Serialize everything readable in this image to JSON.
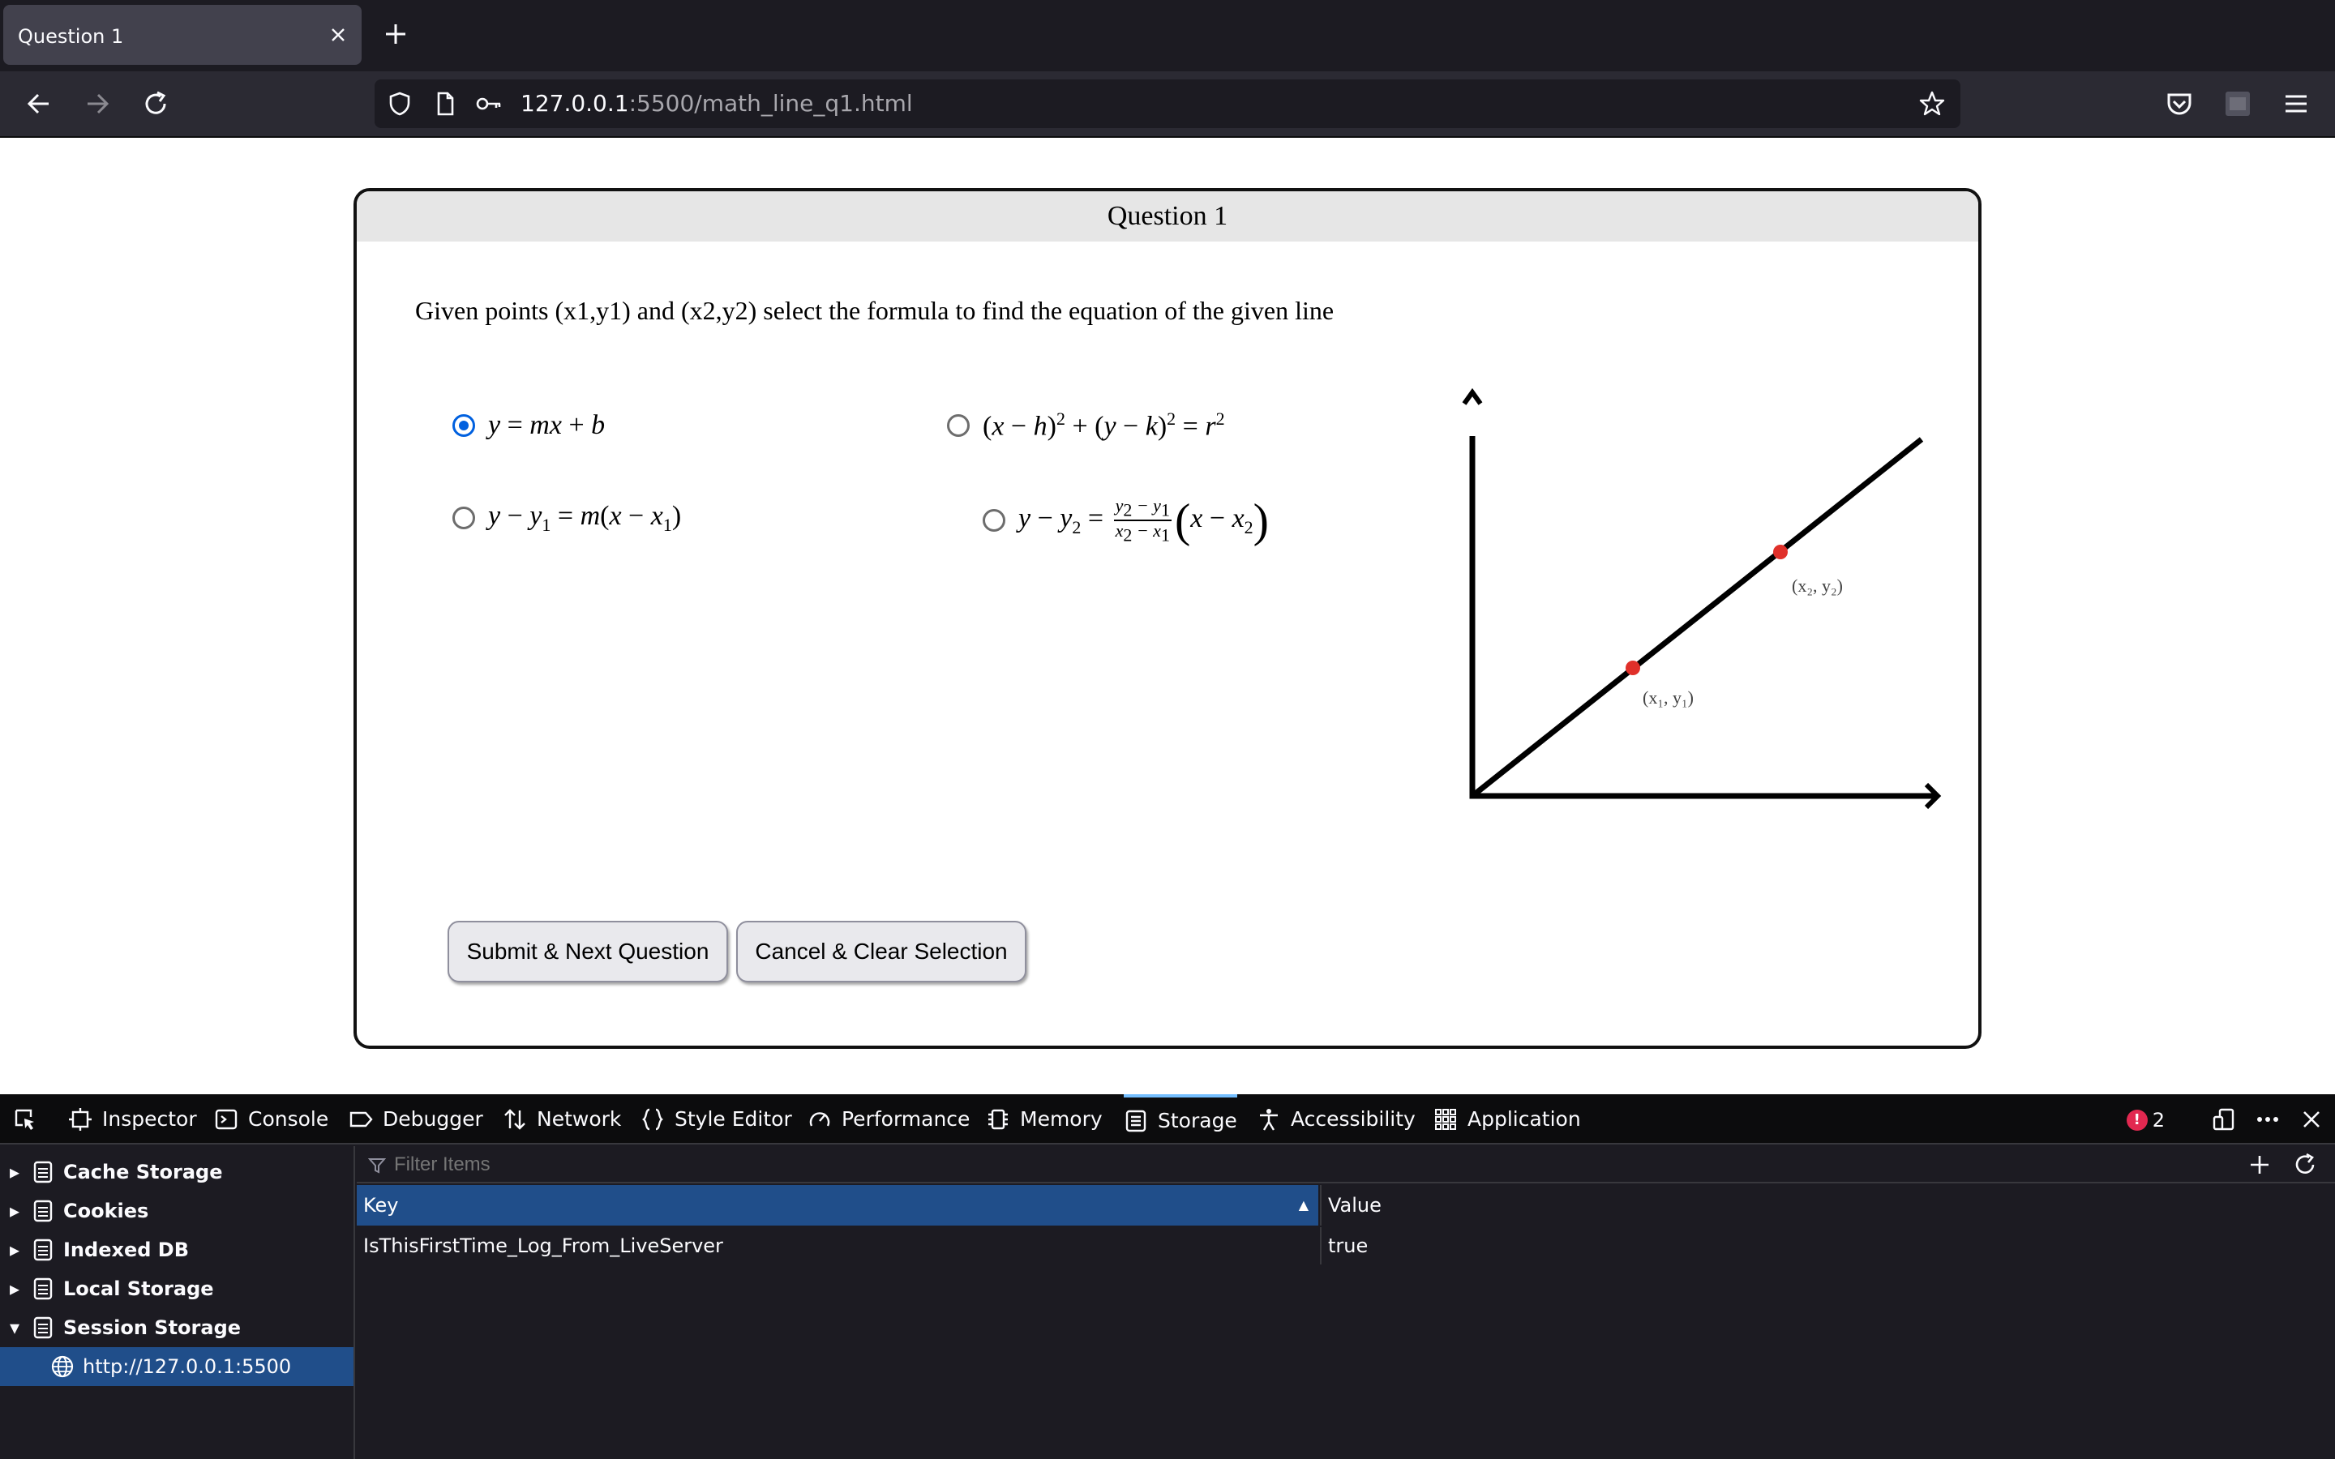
{
  "browser": {
    "tab_title": "Question 1",
    "url_host": "127.0.0.1",
    "url_rest": ":5500/math_line_q1.html"
  },
  "question": {
    "header": "Question 1",
    "text": "Given points (x1,y1) and (x2,y2) select the formula to find the equation of the given line",
    "selected_option": 1,
    "options": [
      {
        "id": "slope-intercept",
        "label": "y = mx + b"
      },
      {
        "id": "circle",
        "label": "(x − h)2 + (y − k)2 = r2"
      },
      {
        "id": "point-slope",
        "label": "y − y1 = m(x − x1)"
      },
      {
        "id": "two-point",
        "label": "y − y2 = (y2 − y1)/(x2 − x1) (x − x2)"
      }
    ],
    "graph": {
      "point1_label": "(x₁, y₁)",
      "point2_label": "(x₂, y₂)",
      "point_color": "#e0302a"
    },
    "submit_label": "Submit & Next Question",
    "cancel_label": "Cancel & Clear Selection"
  },
  "devtools": {
    "tabs": [
      "Inspector",
      "Console",
      "Debugger",
      "Network",
      "Style Editor",
      "Performance",
      "Memory",
      "Storage",
      "Accessibility",
      "Application"
    ],
    "active_tab": "Storage",
    "error_count": "2",
    "filter_placeholder": "Filter Items",
    "tree": [
      "Cache Storage",
      "Cookies",
      "Indexed DB",
      "Local Storage",
      "Session Storage"
    ],
    "tree_selected": "http://127.0.0.1:5500",
    "table": {
      "key_header": "Key",
      "value_header": "Value",
      "rows": [
        {
          "key": "IsThisFirstTime_Log_From_LiveServer",
          "value": "true"
        }
      ]
    }
  }
}
